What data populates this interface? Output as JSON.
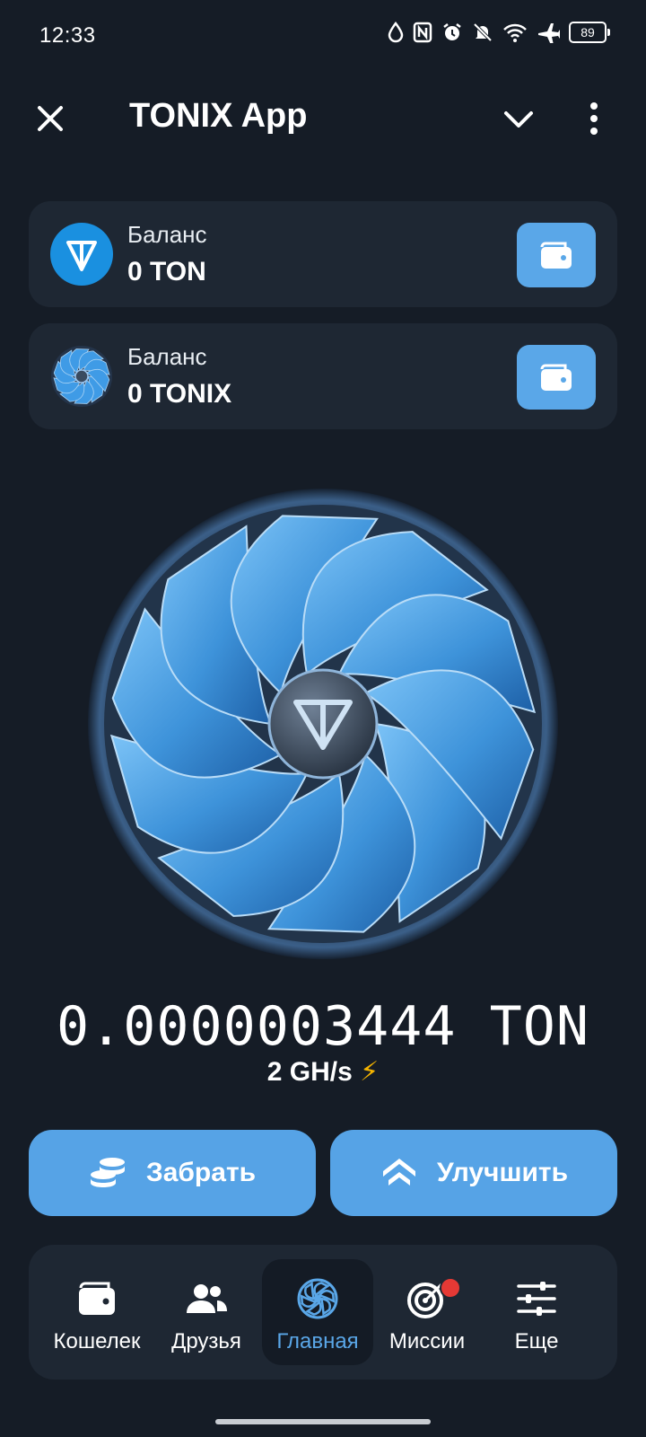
{
  "status_bar": {
    "time": "12:33",
    "battery": "89"
  },
  "app_bar": {
    "title": "TONIX App"
  },
  "balances": [
    {
      "label": "Баланс",
      "value": "0 TON",
      "coin_icon": "ton-logo-icon"
    },
    {
      "label": "Баланс",
      "value": "0 TONIX",
      "coin_icon": "tonix-fan-icon"
    }
  ],
  "mining": {
    "counter": "0.0000003444 TON",
    "rate": "2 GH/s",
    "rate_icon": "⚡"
  },
  "actions": {
    "claim_label": "Забрать",
    "upgrade_label": "Улучшить"
  },
  "nav": {
    "items": [
      {
        "label": "Кошелек",
        "icon": "wallet-icon"
      },
      {
        "label": "Друзья",
        "icon": "friends-icon"
      },
      {
        "label": "Главная",
        "icon": "fan-icon",
        "active": true
      },
      {
        "label": "Миссии",
        "icon": "target-icon",
        "badge": true
      },
      {
        "label": "Еще",
        "icon": "sliders-icon"
      }
    ]
  },
  "colors": {
    "background": "#151c26",
    "card": "#1e2733",
    "accent": "#56a3e6",
    "active_text": "#5aa7e8",
    "badge": "#e53935"
  }
}
